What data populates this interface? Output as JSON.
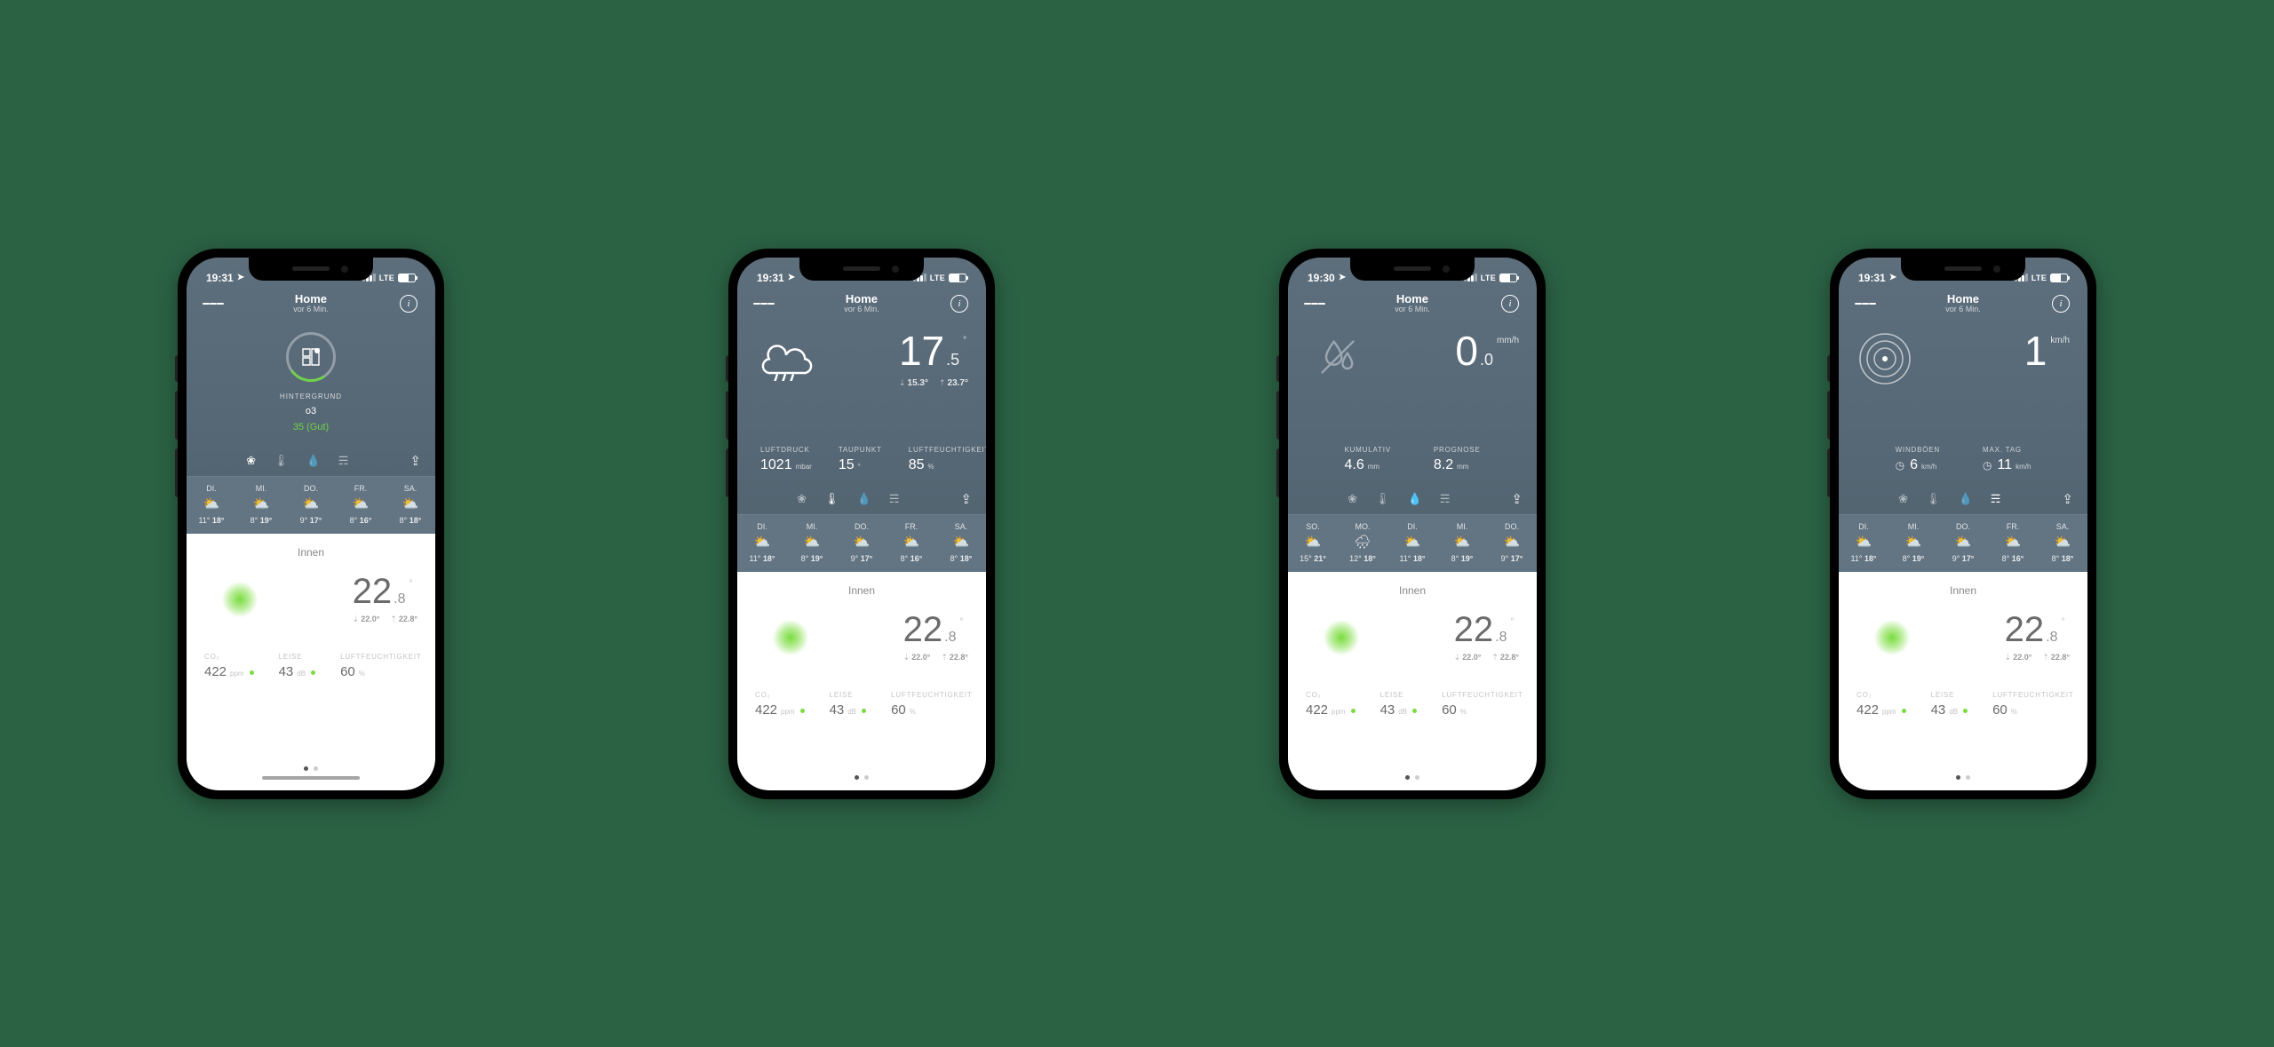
{
  "common": {
    "app_title": "Home",
    "subtitle": "vor 6 Min.",
    "lte": "LTE",
    "indoor_title": "Innen",
    "indoor_temp_whole": "22",
    "indoor_temp_frac": ".8",
    "indoor_temp_unit": "°",
    "indoor_min": "22.0°",
    "indoor_max": "22.8°",
    "co2_label": "CO₂",
    "co2_value": "422",
    "co2_unit": "ppm",
    "noise_label": "LEISE",
    "noise_value": "43",
    "noise_unit": "dB",
    "hum_label": "LUFTFEUCHTIGKEIT",
    "hum_value": "60",
    "hum_unit": "%"
  },
  "phones": [
    {
      "time": "19:31",
      "hero_type": "air",
      "air": {
        "label": "HINTERGRUND",
        "sub": "o3",
        "value": "35 (Gut)"
      },
      "active_tab": 0,
      "forecast": [
        {
          "d": "DI.",
          "lo": "11°",
          "hi": "18°"
        },
        {
          "d": "MI.",
          "lo": "8°",
          "hi": "19°"
        },
        {
          "d": "DO.",
          "lo": "9°",
          "hi": "17°"
        },
        {
          "d": "FR.",
          "lo": "8°",
          "hi": "16°"
        },
        {
          "d": "SA.",
          "lo": "8°",
          "hi": "18°"
        }
      ],
      "show_homebar": true
    },
    {
      "time": "19:31",
      "hero_type": "temp",
      "temp": {
        "whole": "17",
        "frac": ".5",
        "unit": "°",
        "min": "15.3°",
        "max": "23.7°"
      },
      "stats": [
        {
          "lab": "LUFTDRUCK",
          "v": "1021",
          "u": "mbar"
        },
        {
          "lab": "TAUPUNKT",
          "v": "15",
          "u": "°"
        },
        {
          "lab": "LUFTFEUCHTIGKEIT",
          "v": "85",
          "u": "%"
        }
      ],
      "active_tab": 1,
      "forecast": [
        {
          "d": "DI.",
          "lo": "11°",
          "hi": "18°"
        },
        {
          "d": "MI.",
          "lo": "8°",
          "hi": "19°"
        },
        {
          "d": "DO.",
          "lo": "9°",
          "hi": "17°"
        },
        {
          "d": "FR.",
          "lo": "8°",
          "hi": "16°"
        },
        {
          "d": "SA.",
          "lo": "8°",
          "hi": "18°"
        }
      ],
      "show_homebar": false
    },
    {
      "time": "19:30",
      "hero_type": "rain",
      "rain": {
        "whole": "0",
        "frac": ".0",
        "unit": "mm/h"
      },
      "stats": [
        {
          "lab": "KUMULATIV",
          "v": "4.6",
          "u": "mm"
        },
        {
          "lab": "PROGNOSE",
          "v": "8.2",
          "u": "mm"
        }
      ],
      "active_tab": 2,
      "forecast": [
        {
          "d": "SO.",
          "lo": "15°",
          "hi": "21°"
        },
        {
          "d": "MO.",
          "lo": "12°",
          "hi": "18°"
        },
        {
          "d": "DI.",
          "lo": "11°",
          "hi": "18°"
        },
        {
          "d": "MI.",
          "lo": "8°",
          "hi": "19°"
        },
        {
          "d": "DO.",
          "lo": "9°",
          "hi": "17°"
        }
      ],
      "show_homebar": false
    },
    {
      "time": "19:31",
      "hero_type": "wind",
      "wind": {
        "whole": "1",
        "unit": "km/h"
      },
      "stats": [
        {
          "lab": "WINDBÖEN",
          "v": "6",
          "u": "km/h",
          "icon": "clock"
        },
        {
          "lab": "MAX. TAG",
          "v": "11",
          "u": "km/h",
          "icon": "clock"
        }
      ],
      "active_tab": 3,
      "forecast": [
        {
          "d": "DI.",
          "lo": "11°",
          "hi": "18°"
        },
        {
          "d": "MI.",
          "lo": "8°",
          "hi": "19°"
        },
        {
          "d": "DO.",
          "lo": "9°",
          "hi": "17°"
        },
        {
          "d": "FR.",
          "lo": "8°",
          "hi": "16°"
        },
        {
          "d": "SA.",
          "lo": "8°",
          "hi": "18°"
        }
      ],
      "show_homebar": false
    }
  ]
}
